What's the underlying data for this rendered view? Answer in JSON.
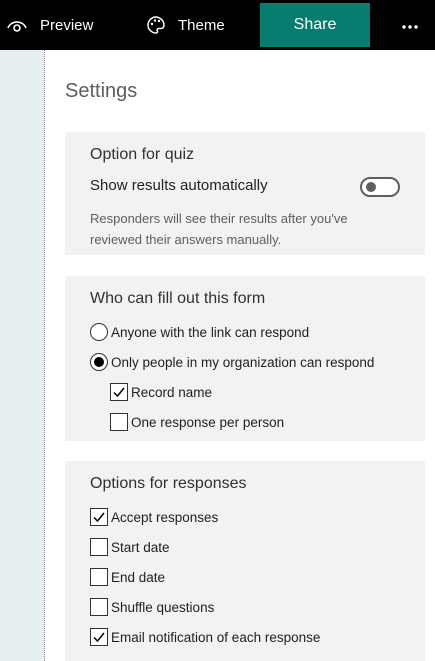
{
  "topbar": {
    "preview_label": "Preview",
    "theme_label": "Theme",
    "share_label": "Share",
    "more_icon": "ellipsis-icon",
    "preview_icon": "eye-icon",
    "theme_icon": "palette-icon",
    "share_color": "#077d6f"
  },
  "panel": {
    "title": "Settings"
  },
  "quiz": {
    "title": "Option for quiz",
    "show_results_label": "Show results automatically",
    "show_results_on": false,
    "description": "Responders will see their results after you've reviewed their answers manually."
  },
  "who": {
    "title": "Who can fill out this form",
    "options": [
      {
        "label": "Anyone with the link can respond",
        "selected": false
      },
      {
        "label": "Only people in my organization can respond",
        "selected": true
      }
    ],
    "record_name_label": "Record name",
    "record_name_checked": true,
    "one_response_label": "One response per person",
    "one_response_checked": false
  },
  "responses": {
    "title": "Options for responses",
    "items": [
      {
        "label": "Accept responses",
        "checked": true
      },
      {
        "label": "Start date",
        "checked": false
      },
      {
        "label": "End date",
        "checked": false
      },
      {
        "label": "Shuffle questions",
        "checked": false
      },
      {
        "label": "Email notification of each response",
        "checked": true
      }
    ]
  }
}
